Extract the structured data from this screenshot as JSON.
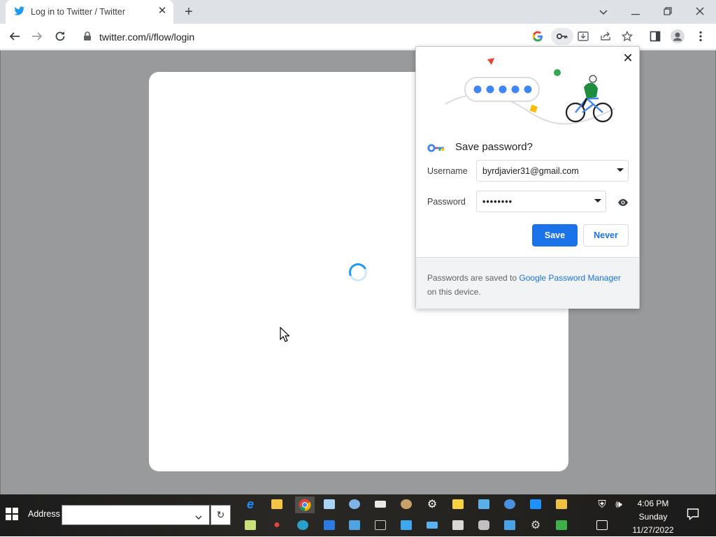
{
  "browser": {
    "tab_title": "Log in to Twitter / Twitter",
    "url": "twitter.com/i/flow/login",
    "window_controls": [
      "chevron-down-icon",
      "minimize-icon",
      "restore-icon",
      "close-icon"
    ]
  },
  "popup": {
    "heading": "Save password?",
    "username_label": "Username",
    "username_value": "byrdjavier31@gmail.com",
    "password_label": "Password",
    "password_value": "••••••••",
    "save_label": "Save",
    "never_label": "Never",
    "footer_text_before": "Passwords are saved to ",
    "footer_link": "Google Password Manager",
    "footer_text_after": " on this device."
  },
  "taskbar": {
    "address_label": "Address",
    "address_value": "",
    "time": "4:06 PM",
    "day": "Sunday",
    "date": "11/27/2022"
  },
  "colors": {
    "accent": "#1a73e8",
    "twitter_blue": "#1d9bf0",
    "page_overlay": "#999a9b"
  }
}
